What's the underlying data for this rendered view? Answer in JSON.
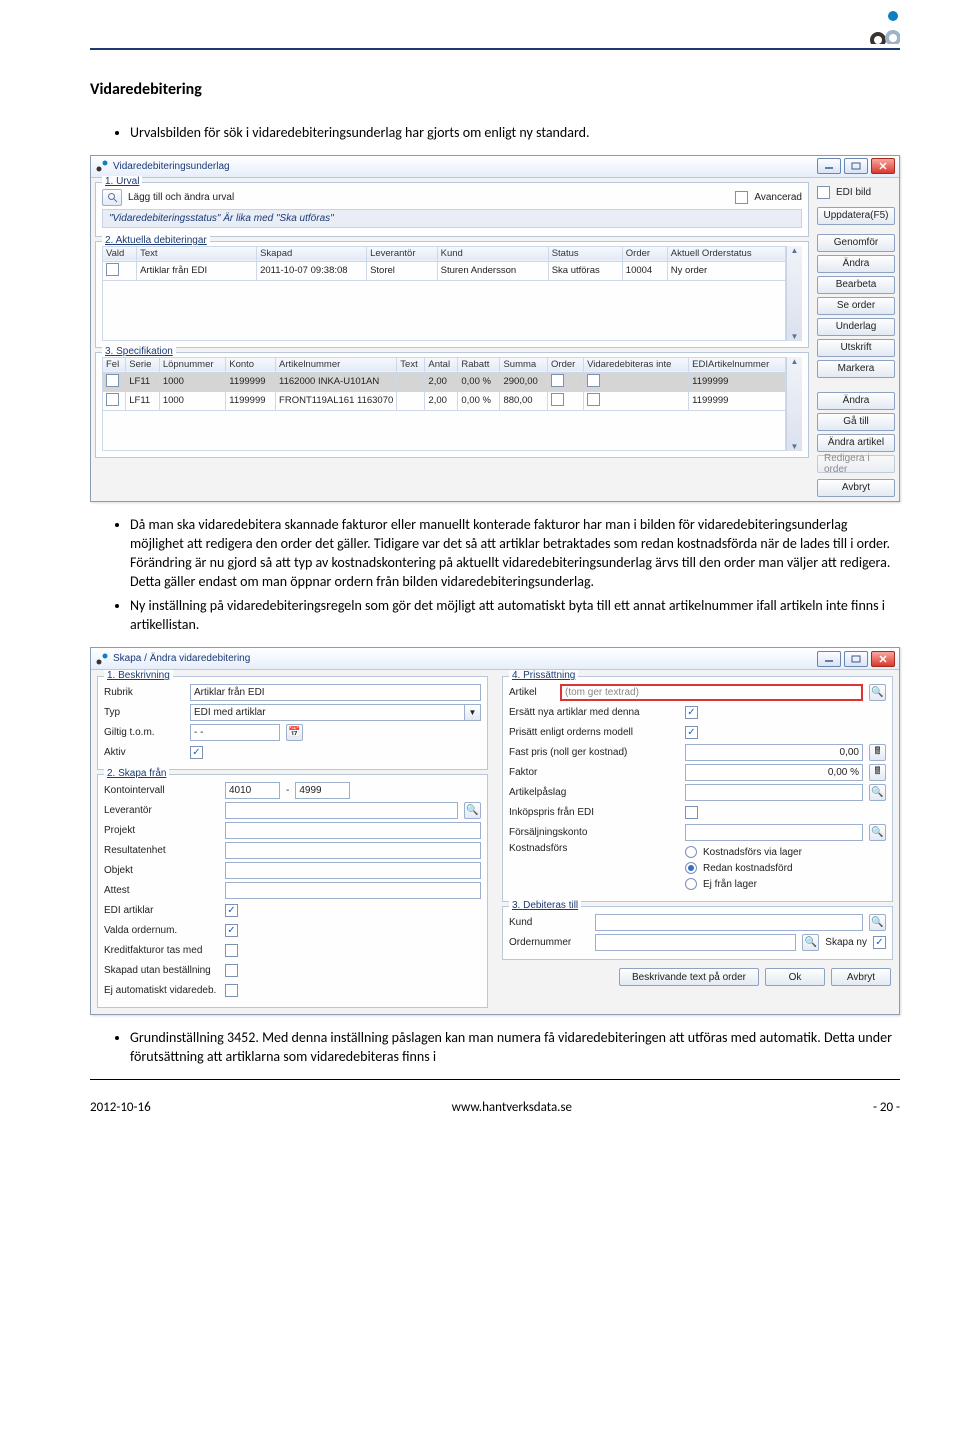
{
  "doc": {
    "heading": "Vidaredebitering",
    "bullet1": "Urvalsbilden för sök i vidaredebiteringsunderlag har gjorts om enligt ny standard.",
    "bullet2": "Då man ska vidaredebitera skannade fakturor eller manuellt konterade fakturor har man i bilden för vidaredebiteringsunderlag möjlighet att redigera den order det gäller. Tidigare var det så att artiklar betraktades som redan kostnadsförda när de lades till i order. Förändring är nu gjord så att typ av kostnadskontering på aktuellt vidaredebiteringsunderlag ärvs till den order man väljer att redigera. Detta gäller endast om man öppnar ordern från bilden vidaredebiteringsunderlag.",
    "bullet3": "Ny inställning på vidaredebiteringsregeln som gör det möjligt att automatiskt byta till ett annat artikelnummer ifall artikeln inte finns i artikellistan.",
    "bullet4": "Grundinställning 3452. Med denna inställning påslagen kan man numera få vidaredebiteringen att utföras med automatik. Detta under förutsättning att artiklarna som vidaredebiteras finns i"
  },
  "win1": {
    "title": "Vidaredebiteringsunderlag",
    "urval_label": "1. Urval",
    "add_urval": "Lägg till och ändra urval",
    "avancerad": "Avancerad",
    "edi_bild": "EDI bild",
    "uppdatera": "Uppdatera(F5)",
    "filter_text": "\"Vidaredebiteringsstatus\" Är lika med \"Ska utföras\"",
    "aktuella_label": "2. Aktuella debiteringar",
    "cols1": [
      "Vald",
      "Text",
      "Skapad",
      "Leverantör",
      "Kund",
      "Status",
      "Order",
      "Aktuell Orderstatus"
    ],
    "row1": [
      "",
      "Artiklar från EDI",
      "2011-10-07 09:38:08",
      "Storel",
      "Sturen Andersson",
      "Ska utföras",
      "10004",
      "Ny order"
    ],
    "btns1": [
      "Genomför",
      "Ändra",
      "Bearbeta",
      "Se order",
      "Underlag",
      "Utskrift",
      "Markera"
    ],
    "spec_label": "3. Specifikation",
    "cols2": [
      "Fel",
      "Serie",
      "Löpnummer",
      "Konto",
      "Artikelnummer",
      "Text",
      "Antal",
      "Rabatt",
      "Summa",
      "Order",
      "Vidaredebiteras inte",
      "EDIArtikelnummer"
    ],
    "rows2": [
      [
        "",
        "LF11",
        "1000",
        "1199999",
        "1162000 INKA-U101AN",
        "",
        "2,00",
        "0,00 %",
        "2900,00",
        "",
        "",
        "1199999"
      ],
      [
        "",
        "LF11",
        "1000",
        "1199999",
        "FRONT119AL161 1163070",
        "",
        "2,00",
        "0,00 %",
        "880,00",
        "",
        "",
        "1199999"
      ]
    ],
    "btns2": [
      "Ändra",
      "Gå till",
      "Ändra artikel",
      "Redigera i order"
    ],
    "avbryt": "Avbryt"
  },
  "win2": {
    "title": "Skapa / Ändra vidaredebitering",
    "g1": "1. Beskrivning",
    "rubrik": "Rubrik",
    "rubrik_val": "Artiklar från EDI",
    "typ": "Typ",
    "typ_val": "EDI med artiklar",
    "giltig": "Giltig t.o.m.",
    "giltig_val": "  -  -",
    "aktiv": "Aktiv",
    "g2": "2. Skapa från",
    "konto": "Kontointervall",
    "konto_a": "4010",
    "konto_b": "4999",
    "lev": "Leverantör",
    "proj": "Projekt",
    "res": "Resultatenhet",
    "obj": "Objekt",
    "att": "Attest",
    "ediart": "EDI artiklar",
    "valdao": "Valda ordernum.",
    "kredit": "Kreditfakturor tas med",
    "skapad": "Skapad utan beställning",
    "ejauto": "Ej automatiskt vidaredeb.",
    "g3": "3. Debiteras till",
    "kund": "Kund",
    "onr": "Ordernummer",
    "skapany": "Skapa ny",
    "g4": "4. Prissättning",
    "art": "Artikel",
    "art_ph": "(tom ger textrad)",
    "ersatt": "Ersätt nya artiklar med denna",
    "prisatt": "Prisätt enligt orderns modell",
    "fast": "Fast pris (noll ger kostnad)",
    "fast_val": "0,00",
    "faktor": "Faktor",
    "faktor_val": "0,00 %",
    "artpa": "Artikelpåslag",
    "inkop": "Inköpspris från EDI",
    "forsk": "Försäljningskonto",
    "kostf": "Kostnadsförs",
    "r1": "Kostnadsförs via lager",
    "r2": "Redan kostnadsförd",
    "r3": "Ej från lager",
    "besk_btn": "Beskrivande text på order",
    "ok": "Ok",
    "avbryt": "Avbryt"
  },
  "footer": {
    "date": "2012-10-16",
    "url": "www.hantverksdata.se",
    "page": "- 20 -"
  }
}
